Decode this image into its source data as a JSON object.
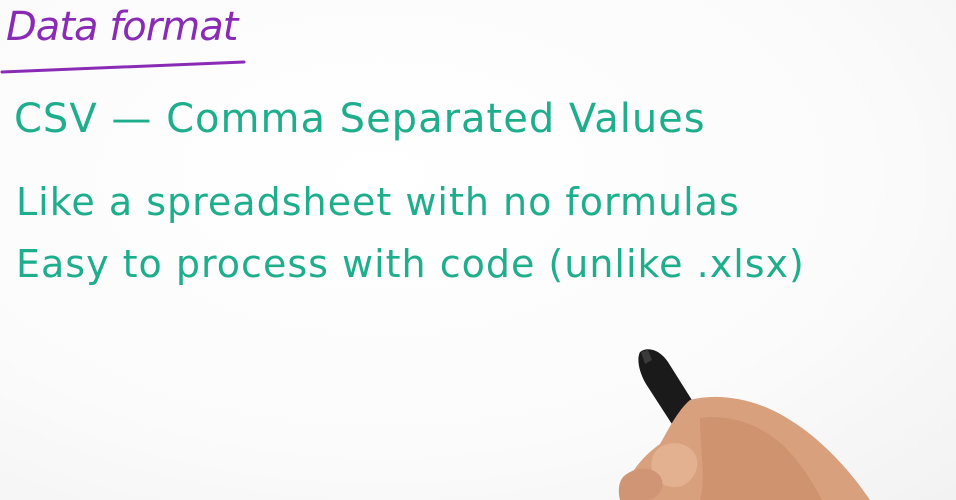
{
  "board": {
    "title": "Data format",
    "lines": [
      "CSV — Comma Separated Values",
      "Like a spreadsheet with no formulas",
      "Easy to process with code (unlike .xlsx)"
    ]
  },
  "colors": {
    "title": "#8a2bb5",
    "body_text": "#1fae8c",
    "marker": "#1a1a1a",
    "skin": "#d9a07e"
  },
  "icons": {
    "hand": "hand-holding-marker-icon"
  }
}
